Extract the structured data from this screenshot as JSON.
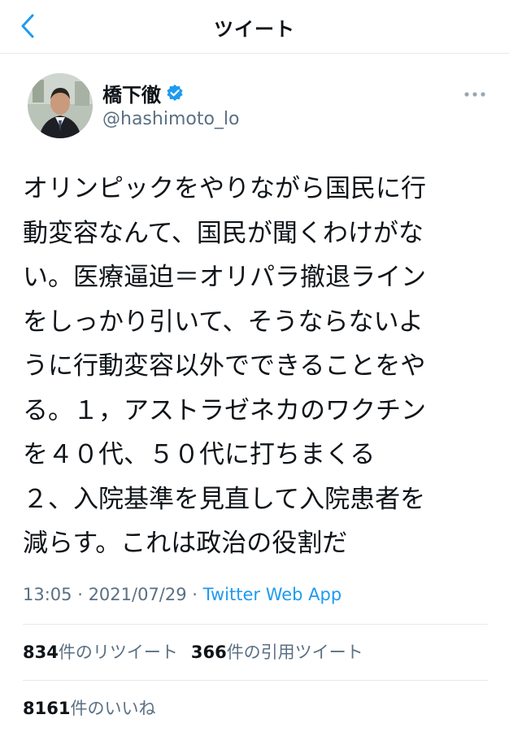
{
  "header": {
    "title": "ツイート",
    "back_icon": "chevron-left-icon"
  },
  "author": {
    "display_name": "橋下徹",
    "handle": "@hashimoto_lo",
    "verified": true
  },
  "tweet": {
    "lines": [
      "オリンピックをやりながら国民に行",
      "動変容なんて、国民が聞くわけがな",
      "い。医療逼迫＝オリパラ撤退ライン",
      "をしっかり引いて、そうならないよ",
      "うに行動変容以外でできることをや",
      "る。１，アストラゼネカのワクチン",
      "を４０代、５０代に打ちまくる",
      "２、入院基準を見直して入院患者を",
      "減らす。これは政治の役割だ"
    ]
  },
  "meta": {
    "time": "13:05",
    "sep1": " · ",
    "date": "2021/07/29",
    "sep2": " · ",
    "source": "Twitter Web App"
  },
  "stats": {
    "retweets": {
      "count": "834",
      "label": "件のリツイート"
    },
    "quotes": {
      "count": "366",
      "label": "件の引用ツイート"
    },
    "likes": {
      "count": "8161",
      "label": "件のいいね"
    }
  },
  "colors": {
    "accent": "#1d9bf0",
    "muted": "#5b7083",
    "divider": "#e6e9ec"
  }
}
